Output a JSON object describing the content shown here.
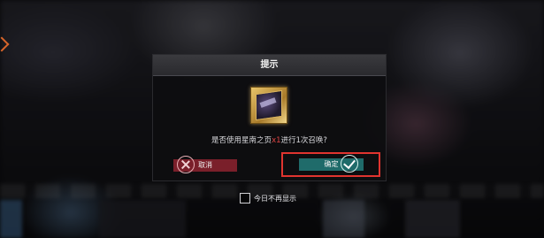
{
  "dialog": {
    "title": "提示",
    "item_icon": "gold-card-item-icon",
    "prompt_prefix": "是否使用星南之页",
    "prompt_count": "x1",
    "prompt_suffix": "进行1次召唤?",
    "cancel_label": "取消",
    "confirm_label": "确定"
  },
  "footer": {
    "no_show_today_label": "今日不再显示",
    "no_show_today_checked": false
  },
  "colors": {
    "cancel": "#7a1f2a",
    "confirm": "#1f6b6a",
    "highlight": "#e0342f",
    "count_text": "#e04545"
  }
}
